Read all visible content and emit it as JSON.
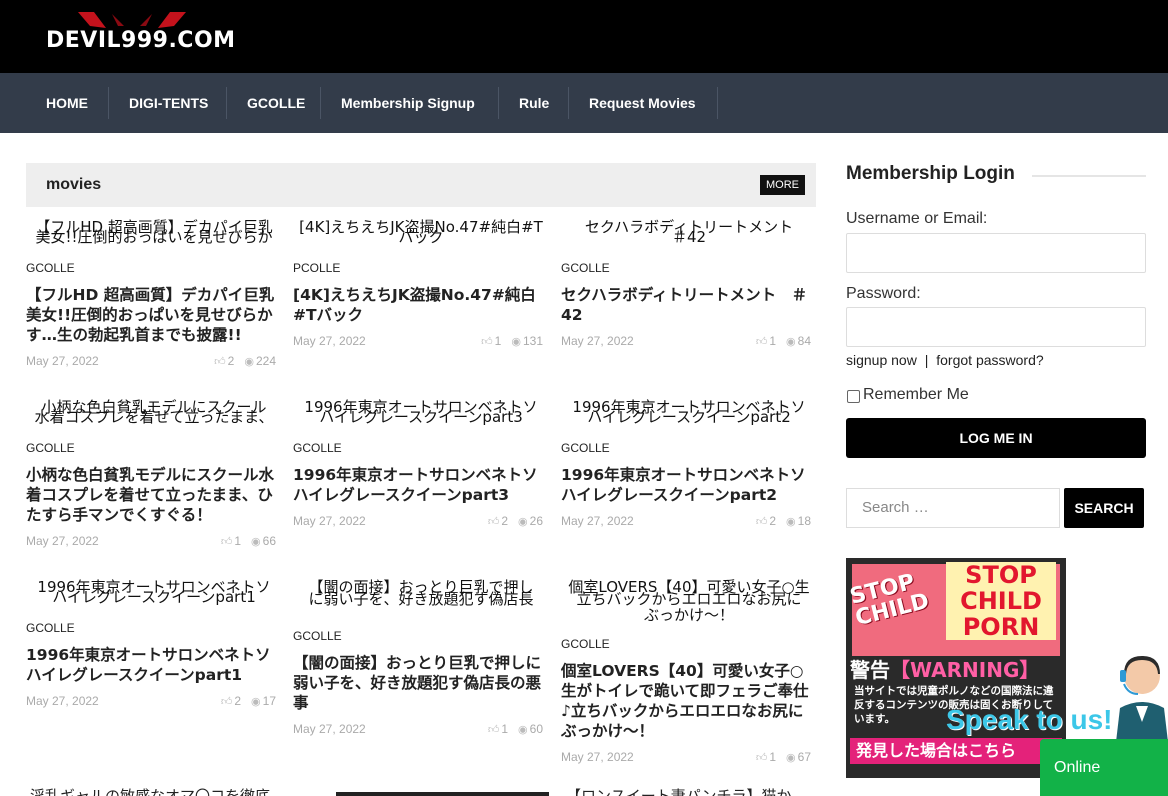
{
  "site": {
    "logo_text": "DEVIL999.COM"
  },
  "nav": {
    "items": [
      "HOME",
      "DIGI-TENTS",
      "GCOLLE",
      "Membership Signup",
      "Rule",
      "Request Movies"
    ]
  },
  "section": {
    "title": "movies",
    "more_label": "MORE"
  },
  "cards": [
    {
      "thumb_alt": [
        "【フルHD 超高画質】デカパイ巨乳",
        "美女!!圧倒的おっぱいを見せびらか",
        "す…生の勃起乳首までも披露!!"
      ],
      "category": "GCOLLE",
      "title": "【フルHD 超高画質】デカパイ巨乳美女!!圧倒的おっぱいを見せびらかす…生の勃起乳首までも披露!!",
      "date": "May 27, 2022",
      "likes": "2",
      "views": "224"
    },
    {
      "thumb_alt": [
        "[4K]えちえちJK盗撮No.47#純白#T",
        "バック"
      ],
      "category": "PCOLLE",
      "title": "[4K]えちえちJK盗撮No.47#純白#Tバック",
      "date": "May 27, 2022",
      "likes": "1",
      "views": "131"
    },
    {
      "thumb_alt": [
        "セクハラボディトリートメント",
        "＃42"
      ],
      "category": "GCOLLE",
      "title": "セクハラボディトリートメント　＃42",
      "date": "May 27, 2022",
      "likes": "1",
      "views": "84"
    },
    {
      "thumb_alt": [
        "小柄な色白貧乳モデルにスクール",
        "水着コスプレを着せて立ったまま、",
        "ひたすら手マンでくすぐる！"
      ],
      "category": "GCOLLE",
      "title": "小柄な色白貧乳モデルにスクール水着コスプレを着せて立ったまま、ひたすら手マンでくすぐる！",
      "date": "May 27, 2022",
      "likes": "1",
      "views": "66"
    },
    {
      "thumb_alt": [
        "1996年東京オートサロンベネトソ",
        "ハイレグレースクイーンpart3"
      ],
      "category": "GCOLLE",
      "title": "1996年東京オートサロンベネトソハイレグレースクイーンpart3",
      "date": "May 27, 2022",
      "likes": "2",
      "views": "26"
    },
    {
      "thumb_alt": [
        "1996年東京オートサロンベネトソ",
        "ハイレグレースクイーンpart2"
      ],
      "category": "GCOLLE",
      "title": "1996年東京オートサロンベネトソハイレグレースクイーンpart2",
      "date": "May 27, 2022",
      "likes": "2",
      "views": "18"
    },
    {
      "thumb_alt": [
        "1996年東京オートサロンベネトソ",
        "ハイレグレースクイーンpart1"
      ],
      "category": "GCOLLE",
      "title": "1996年東京オートサロンベネトソハイレグレースクイーンpart1",
      "date": "May 27, 2022",
      "likes": "2",
      "views": "17"
    },
    {
      "thumb_alt": [
        "【闇の面接】おっとり巨乳で押し",
        "に弱い子を、好き放題犯す偽店長",
        "の悪事"
      ],
      "category": "GCOLLE",
      "title": "【闇の面接】おっとり巨乳で押しに弱い子を、好き放題犯す偽店長の悪事",
      "date": "May 27, 2022",
      "likes": "1",
      "views": "60"
    },
    {
      "thumb_alt": [
        "個室LOVERS【40】可愛い女子○生",
        "がトイレで跪いて即フェラご奉仕♪",
        "立ちバックからエロエロなお尻に",
        "ぶっかけ〜！"
      ],
      "category": "GCOLLE",
      "title": "個室LOVERS【40】可愛い女子○生がトイレで跪いて即フェラご奉仕♪立ちバックからエロエロなお尻にぶっかけ〜！",
      "date": "May 27, 2022",
      "likes": "1",
      "views": "67"
    }
  ],
  "bottom_row": [
    "淫乱ギャルの敏感なオマ〇コを徹底",
    "【ロンスイート妻パンチラ】猫か"
  ],
  "sidebar": {
    "login_title": "Membership Login",
    "username_label": "Username or Email:",
    "password_label": "Password:",
    "signup_link": "signup now",
    "link_sep": "|",
    "forgot_link": "forgot password?",
    "remember_label": "Remember Me",
    "login_button": "LOG ME IN",
    "search_placeholder": "Search …",
    "search_button": "SEARCH"
  },
  "banner": {
    "stop_child": "STOP CHILD",
    "stop_line1": "STOP",
    "stop_line2": "CHILD",
    "stop_line3": "PORN",
    "warning_jp": "警告",
    "warning_en": "【WARNING】",
    "body": "当サイトでは児童ポルノなどの国際法に違反するコンテンツの販売は固くお断りしています。",
    "footer": "発見した場合はこちら"
  },
  "chat": {
    "speak": "Speak to us!",
    "status": "Online"
  }
}
